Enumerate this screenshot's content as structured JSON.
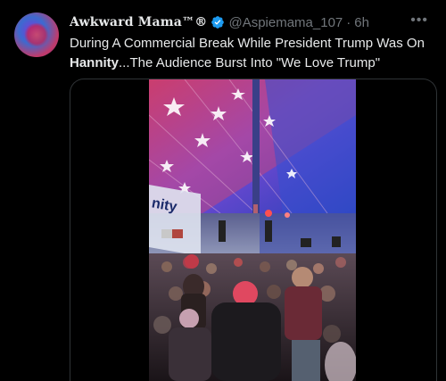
{
  "tweet": {
    "display_name": "Awkward Mama™®",
    "handle": "@Aspiemama_107",
    "separator": "·",
    "time": "6h",
    "more_icon": "more-horizontal-icon",
    "text_line1": "During A Commercial Break While President Trump Was On",
    "text_bold": "Hannity",
    "text_rest": "...The Audience Burst Into \"We Love Trump\""
  },
  "media": {
    "sign_text": "nity"
  },
  "colors": {
    "background": "#000000",
    "verified": "#1d9bf0",
    "muted": "#71767b"
  }
}
